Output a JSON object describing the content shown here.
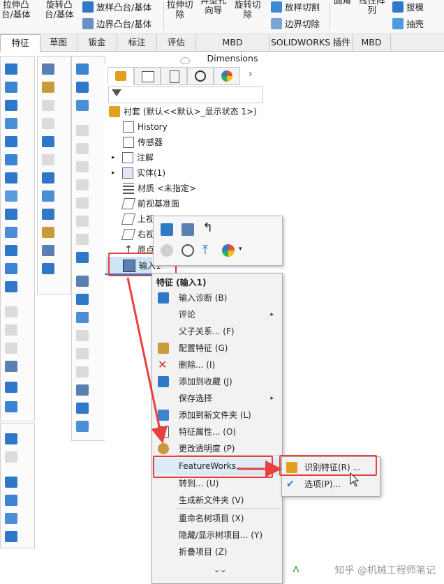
{
  "ribbon": {
    "big_buttons": [
      "拉伸凸\n台/基体",
      "旋转凸\n台/基体",
      "拉伸切\n除",
      "异型孔\n向导",
      "旋转切\n除",
      "圆角",
      "线性阵\n列"
    ],
    "small_top": [
      "放样凸台/基体",
      "放样切割",
      "拔模"
    ],
    "small_bottom": [
      "边界凸台/基体",
      "边界切除",
      "抽壳"
    ]
  },
  "tabs": [
    "特征",
    "草图",
    "钣金",
    "标注",
    "评估",
    "MBD Dimensions",
    "SOLIDWORKS 插件",
    "MBD"
  ],
  "feature_tree": {
    "root": "衬套 (默认<<默认>_显示状态 1>)",
    "items": [
      "History",
      "传感器",
      "注解",
      "实体(1)",
      "材质 <未指定>",
      "前视基准面",
      "上视",
      "右视",
      "原点",
      "输入1"
    ]
  },
  "context_menu": {
    "header": "特征 (输入1)",
    "items": [
      {
        "label": "输入诊断 (B)",
        "icon": "import-diagnosis-icon"
      },
      {
        "label": "评论",
        "icon": "",
        "submenu": "▸"
      },
      {
        "label": "父子关系... (F)",
        "icon": ""
      },
      {
        "label": "配置特征 (G)",
        "icon": "configure-feature-icon"
      },
      {
        "label": "删除... (I)",
        "icon": "delete-icon"
      },
      {
        "label": "添加到收藏 (J)",
        "icon": "favorite-icon"
      },
      {
        "label": "保存选择",
        "icon": "",
        "submenu": "▸"
      },
      {
        "label": "添加到新文件夹 (L)",
        "icon": "folder-icon"
      },
      {
        "label": "特征属性... (O)",
        "icon": "properties-icon"
      },
      {
        "label": "更改透明度 (P)",
        "icon": "transparency-icon"
      },
      {
        "label": "FeatureWorks...",
        "icon": "",
        "submenu": "▸"
      },
      {
        "label": "转到... (U)",
        "icon": ""
      },
      {
        "label": "生成新文件夹 (V)",
        "icon": ""
      },
      {
        "label": "重命名树项目 (X)",
        "icon": ""
      },
      {
        "label": "隐藏/显示树项目... (Y)",
        "icon": ""
      },
      {
        "label": "折叠项目 (Z)",
        "icon": ""
      }
    ],
    "more": "⌄⌄"
  },
  "submenu": {
    "items": [
      "识别特征(R) ...",
      "选项(P)..."
    ]
  },
  "watermark": "知乎 @机械工程师笔记",
  "colors": {
    "highlight": "#e8403f",
    "icon_blue": "#2f78c8",
    "icon_gray": "#b8b8b8"
  }
}
